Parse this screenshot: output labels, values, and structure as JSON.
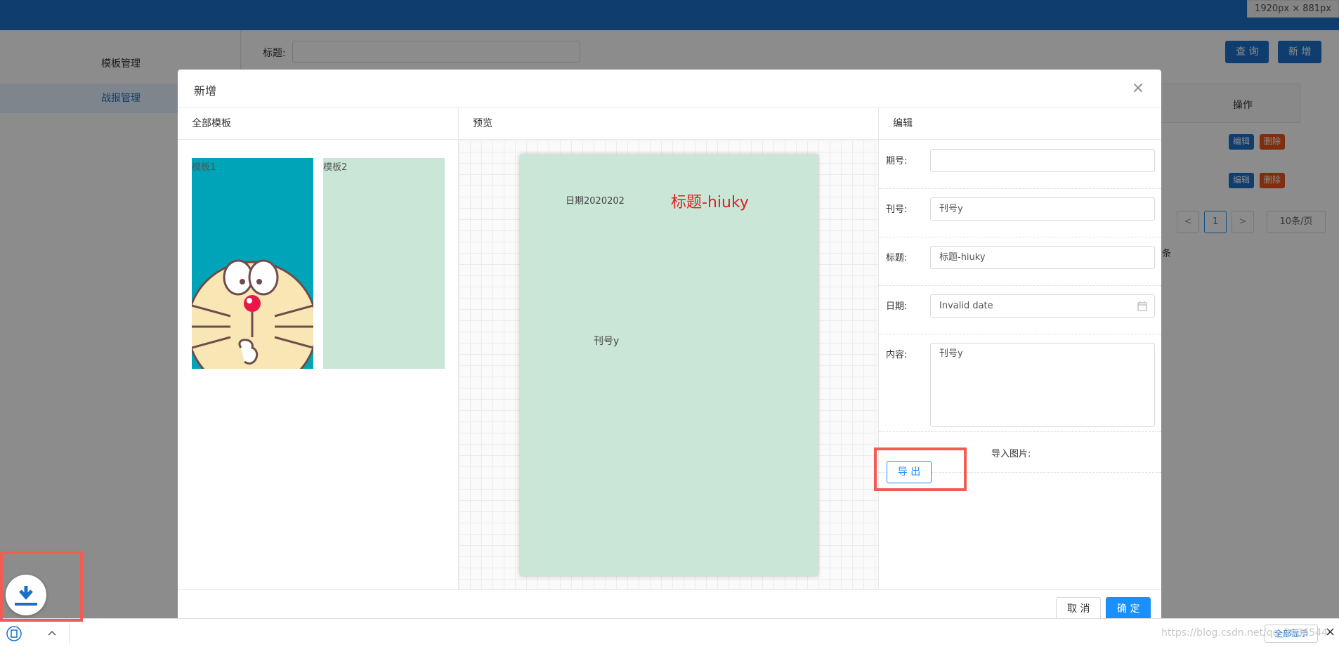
{
  "screen": {
    "dimensions_tag": "1920px × 881px"
  },
  "sidebar": {
    "items": [
      {
        "label": "模板管理"
      },
      {
        "label": "战报管理"
      }
    ]
  },
  "search": {
    "label": "标题:"
  },
  "toolbar": {
    "query_label": "查 询",
    "add_label": "新 增"
  },
  "table": {
    "op_header": "操作",
    "rows": [
      {
        "edit": "编辑",
        "delete": "删除"
      },
      {
        "edit": "编辑",
        "delete": "删除"
      }
    ]
  },
  "pagination": {
    "total_suffix": "条",
    "prev": "<",
    "current": "1",
    "next": ">",
    "page_size": "10条/页"
  },
  "modal": {
    "title": "新增",
    "close_icon": "×",
    "templates_header": "全部模板",
    "preview_header": "预览",
    "edit_header": "编辑",
    "templates": [
      {
        "label": "模板1"
      },
      {
        "label": "模板2"
      }
    ],
    "preview": {
      "date_text": "日期2020202",
      "title_text": "标题-hiuky",
      "issue_text": "刊号y"
    },
    "form": {
      "period_label": "期号:",
      "period_value": "",
      "issue_label": "刊号:",
      "issue_value": "刊号y",
      "title_label": "标题:",
      "title_value": "标题-hiuky",
      "date_label": "日期:",
      "date_value": "Invalid date",
      "content_label": "内容:",
      "content_value": "刊号y",
      "import_label": "导入图片:"
    },
    "export_label": "导 出",
    "cancel_label": "取 消",
    "confirm_label": "确 定"
  },
  "download_bar": {
    "show_all": "全部显示",
    "close": "×"
  },
  "watermark": "https://blog.csdn.net/qq_2086544",
  "colors": {
    "topbar": "#1a6fc9",
    "primary": "#1890ff",
    "danger": "#e6541b",
    "highlight": "#f25c54",
    "paper": "#c9e6d6",
    "title_red": "#e02020"
  }
}
